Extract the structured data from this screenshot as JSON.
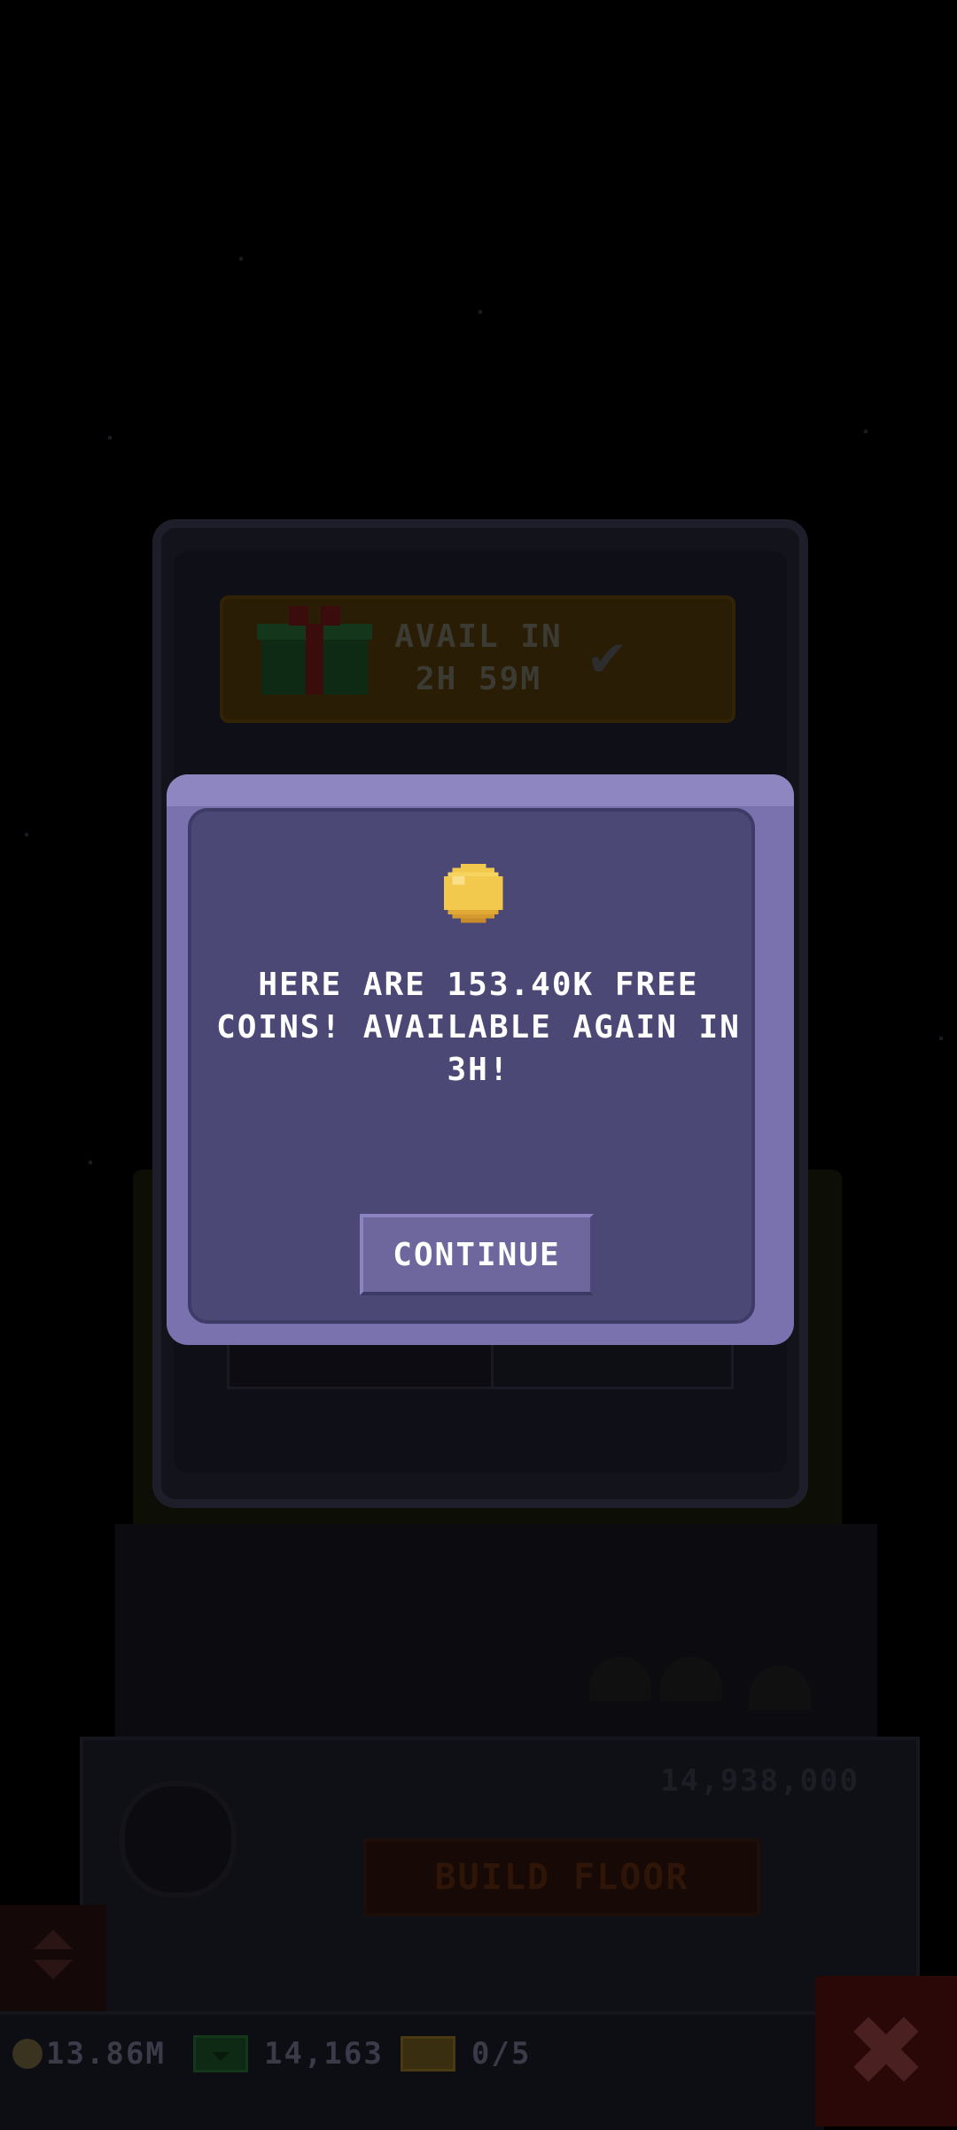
{
  "rewards_panel": {
    "gift_status_line1": "AVAIL IN",
    "gift_status_line2": "2H 59M"
  },
  "dialog": {
    "message": "HERE ARE 153.40K FREE COINS! AVAILABLE AGAIN IN 3H!",
    "continue_label": "CONTINUE"
  },
  "tower": {
    "build_label": "BUILD FLOOR",
    "build_cost": "14,938,000"
  },
  "hud": {
    "coins": "13.86M",
    "bux": "14,163",
    "vip_tickets": "0/5"
  },
  "colors": {
    "dialog_fill": "#4b4876",
    "dialog_border": "#7a72ae",
    "coin": "#f2c94c"
  }
}
